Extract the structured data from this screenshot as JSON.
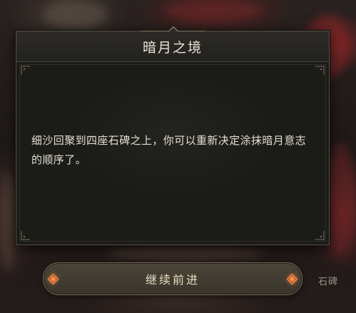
{
  "dialog": {
    "title": "暗月之境",
    "message": "细沙回聚到四座石碑之上，你可以重新决定涂抹暗月意志的顺序了。"
  },
  "continue_button": {
    "label": "继续前进"
  },
  "world_label": {
    "text": "石碑"
  },
  "colors": {
    "panel_bg": "#1b1b18",
    "panel_border": "#5a5448",
    "title_text": "#e9e4d8",
    "button_gem": "#e0662a",
    "button_text": "#e8dcc0"
  }
}
